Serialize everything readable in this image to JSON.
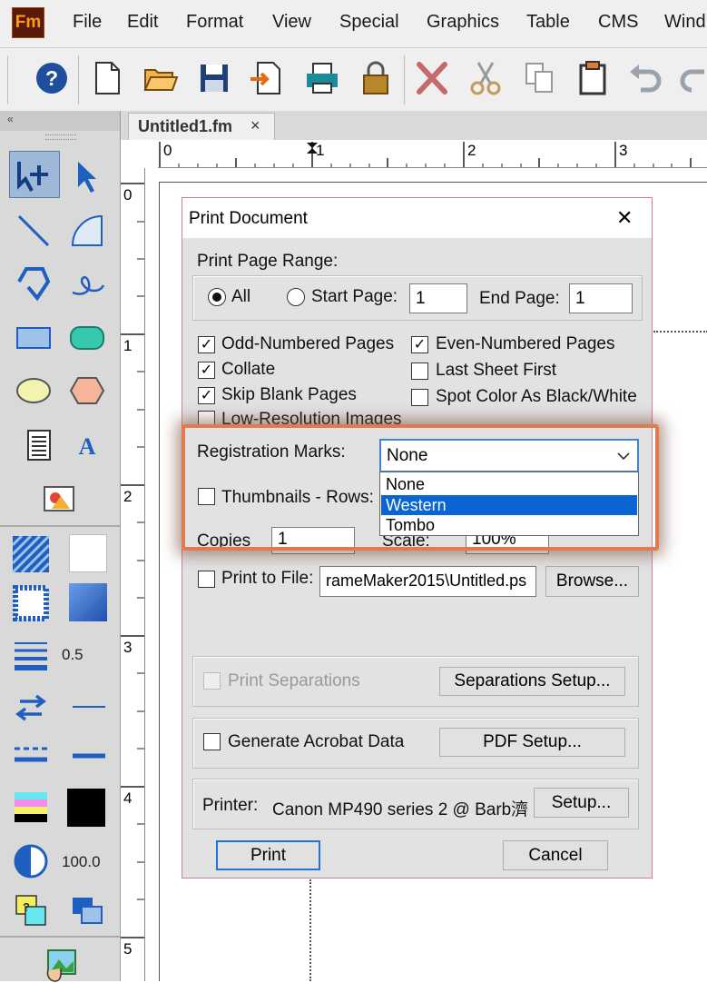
{
  "app": {
    "logo_text": "Fm"
  },
  "menu": [
    "File",
    "Edit",
    "Format",
    "View",
    "Special",
    "Graphics",
    "Table",
    "CMS",
    "Wind"
  ],
  "document_tab": {
    "title": "Untitled1.fm",
    "close": "×"
  },
  "ruler_top": [
    "0",
    "1",
    "2",
    "3"
  ],
  "ruler_left": [
    "0",
    "1",
    "2",
    "3",
    "4",
    "5"
  ],
  "left_panel": {
    "line_width": "0.5",
    "tint": "100.0"
  },
  "dialog": {
    "title": "Print Document",
    "close": "✕",
    "page_range": {
      "label": "Print Page Range:",
      "all_label": "All",
      "start_label": "Start Page:",
      "start_value": "1",
      "end_label": "End Page:",
      "end_value": "1"
    },
    "options": {
      "odd": {
        "label": "Odd-Numbered Pages",
        "checked": true
      },
      "even": {
        "label": "Even-Numbered Pages",
        "checked": true
      },
      "collate": {
        "label": "Collate",
        "checked": true
      },
      "last_sheet_first": {
        "label": "Last Sheet First",
        "checked": false
      },
      "skip_blank": {
        "label": "Skip Blank Pages",
        "checked": true
      },
      "spot_color": {
        "label": "Spot Color As Black/White",
        "checked": false
      },
      "low_res": {
        "label": "Low-Resolution Images",
        "checked": false
      }
    },
    "registration": {
      "label": "Registration Marks:",
      "selected": "None",
      "options": [
        "None",
        "Western",
        "Tombo"
      ],
      "highlighted": "Western"
    },
    "thumbnails": {
      "label": "Thumbnails - Rows:"
    },
    "copies": {
      "label": "Copies:",
      "value": "1"
    },
    "scale": {
      "label": "Scale:",
      "value": "100%"
    },
    "print_to_file": {
      "label": "Print to File:",
      "path": "rameMaker2015\\Untitled.ps",
      "browse": "Browse..."
    },
    "separations": {
      "label": "Print Separations",
      "setup": "Separations Setup..."
    },
    "acrobat": {
      "label": "Generate Acrobat Data",
      "setup": "PDF Setup..."
    },
    "printer": {
      "label": "Printer:",
      "name": "Canon MP490 series 2 @ Barb濟",
      "setup": "Setup..."
    },
    "print_button": "Print",
    "cancel_button": "Cancel"
  },
  "colors": {
    "highlight": "#e07a4f",
    "selection": "#0a64d4",
    "dialog_border": "#d976a8"
  }
}
